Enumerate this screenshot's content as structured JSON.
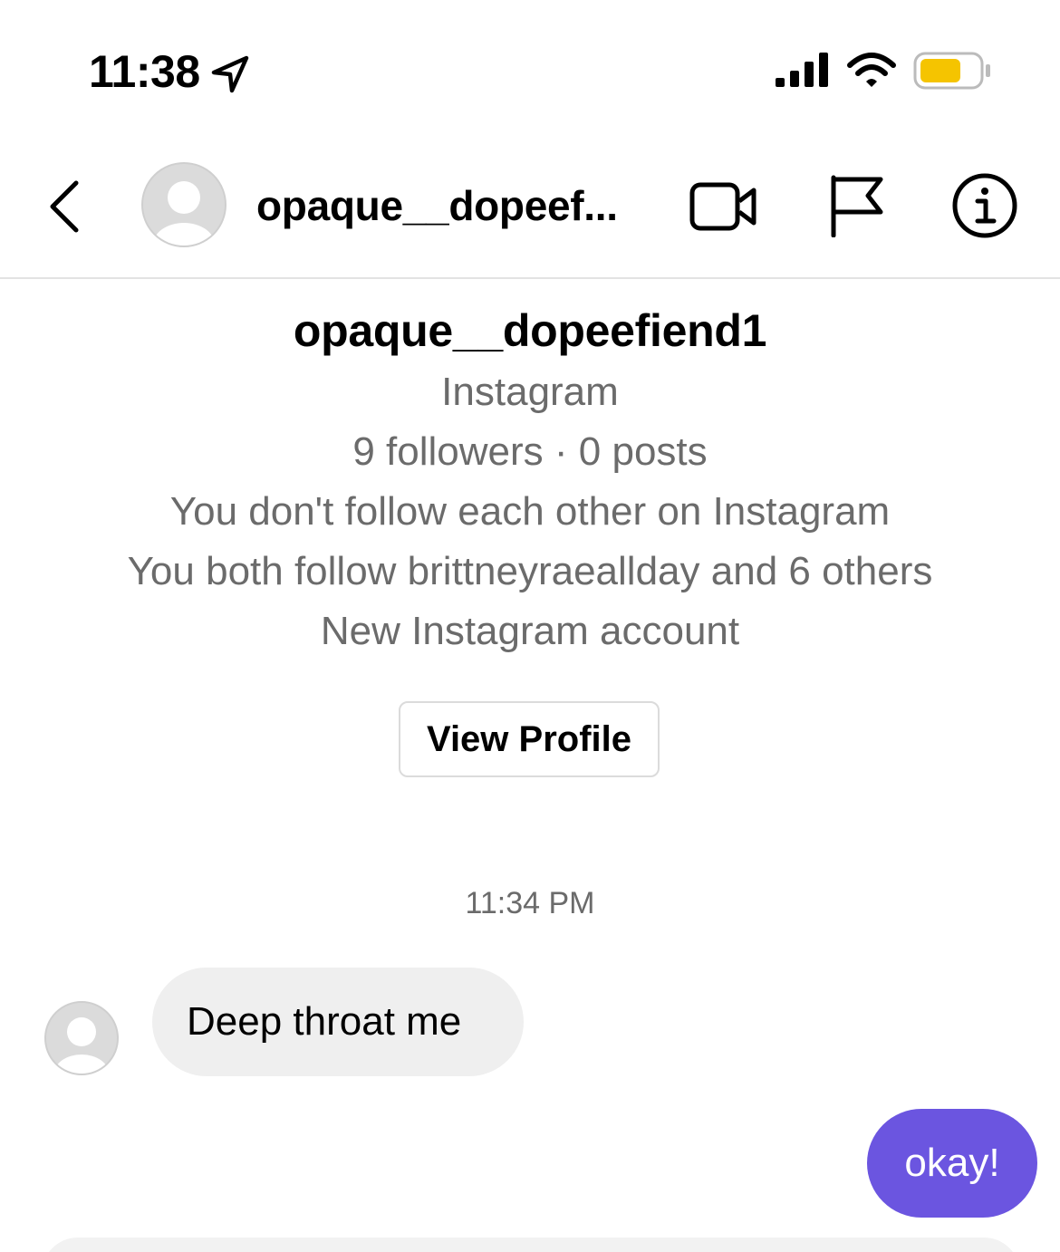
{
  "status_bar": {
    "time": "11:38",
    "location_icon": "location-arrow-icon",
    "signal_icon": "cellular-signal-icon",
    "wifi_icon": "wifi-icon",
    "battery_icon": "battery-icon",
    "battery_color": "#f5c400"
  },
  "header": {
    "back_icon": "chevron-left-icon",
    "name": "opaque__dopeef...",
    "video_icon": "video-camera-icon",
    "flag_icon": "flag-icon",
    "info_icon": "info-icon"
  },
  "profile": {
    "username": "opaque__dopeefiend1",
    "platform": "Instagram",
    "stats": "9 followers · 0 posts",
    "follow_status": "You don't follow each other on Instagram",
    "mutual": "You both follow brittneyraeallday and 6 others",
    "account_note": "New Instagram account",
    "view_profile_label": "View Profile"
  },
  "thread": {
    "timestamp": "11:34 PM",
    "messages": [
      {
        "direction": "incoming",
        "text": "Deep throat me"
      },
      {
        "direction": "outgoing",
        "text": "okay!"
      }
    ]
  },
  "colors": {
    "outgoing_bubble": "#6b55e0",
    "incoming_bubble": "#efefef",
    "secondary_text": "#6b6b6b"
  }
}
